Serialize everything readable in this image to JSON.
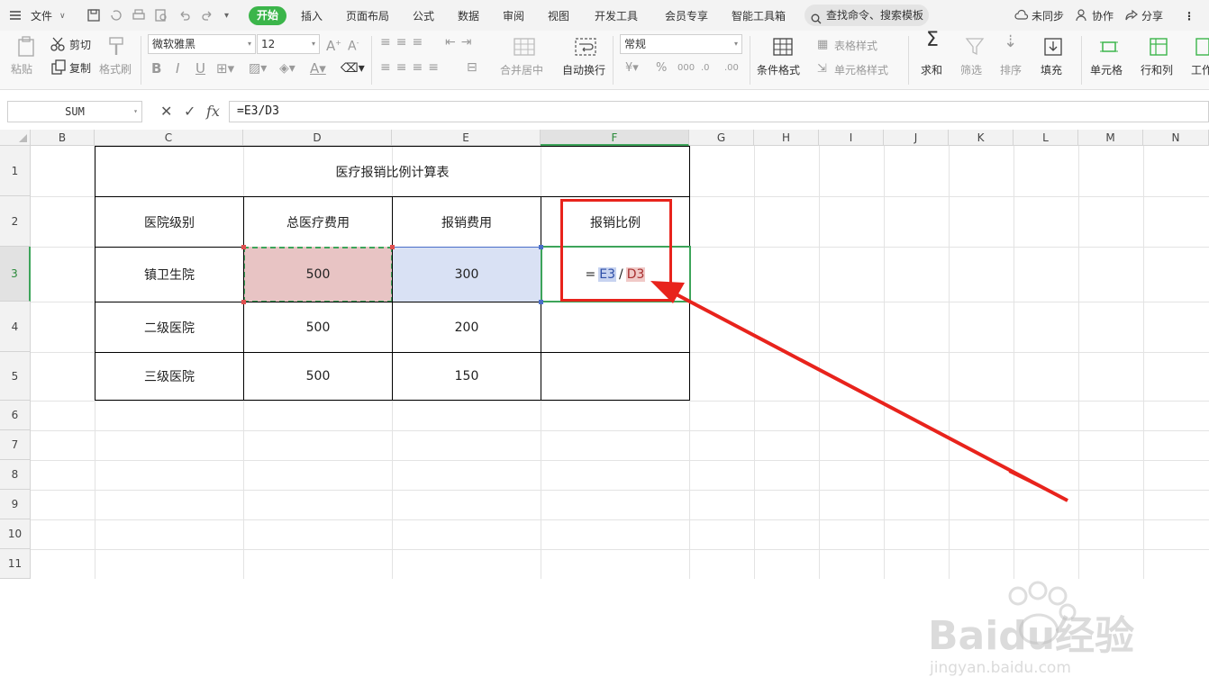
{
  "menu": {
    "file_label": "文件",
    "tabs": [
      "开始",
      "插入",
      "页面布局",
      "公式",
      "数据",
      "审阅",
      "视图",
      "开发工具",
      "会员专享",
      "智能工具箱"
    ],
    "search_placeholder": "查找命令、搜索模板",
    "sync_label": "未同步",
    "collab_label": "协作",
    "share_label": "分享"
  },
  "ribbon": {
    "paste": "粘贴",
    "cut": "剪切",
    "copy": "复制",
    "format_painter": "格式刷",
    "font_name": "微软雅黑",
    "font_size": "12",
    "merge_center": "合并居中",
    "wrap_text": "自动换行",
    "number_format": "常规",
    "conditional_format": "条件格式",
    "table_style": "表格样式",
    "cell_style": "单元格样式",
    "sum": "求和",
    "filter": "筛选",
    "sort": "排序",
    "fill": "填充",
    "cell": "单元格",
    "row_col": "行和列",
    "worksheet": "工作"
  },
  "formula_bar": {
    "name_box": "SUM",
    "formula": "=E3/D3"
  },
  "columns": [
    "B",
    "C",
    "D",
    "E",
    "F",
    "G",
    "H",
    "I",
    "J",
    "K",
    "L",
    "M",
    "N"
  ],
  "rows": [
    "1",
    "2",
    "3",
    "4",
    "5",
    "6",
    "7",
    "8",
    "9",
    "10",
    "11"
  ],
  "table": {
    "title": "医疗报销比例计算表",
    "headers": [
      "医院级别",
      "总医疗费用",
      "报销费用",
      "报销比例"
    ],
    "rows": [
      {
        "level": "镇卫生院",
        "total": "500",
        "reimbursed": "300"
      },
      {
        "level": "二级医院",
        "total": "500",
        "reimbursed": "200"
      },
      {
        "level": "三级医院",
        "total": "500",
        "reimbursed": "150"
      }
    ],
    "editing_formula": {
      "eq": "=",
      "ref1": "E3",
      "op": "/",
      "ref2": "D3"
    }
  },
  "watermark": {
    "brand": "Baidu经验",
    "url": "jingyan.baidu.com"
  },
  "colors": {
    "accent_green": "#3bb54a",
    "annotation_red": "#e8231c"
  }
}
